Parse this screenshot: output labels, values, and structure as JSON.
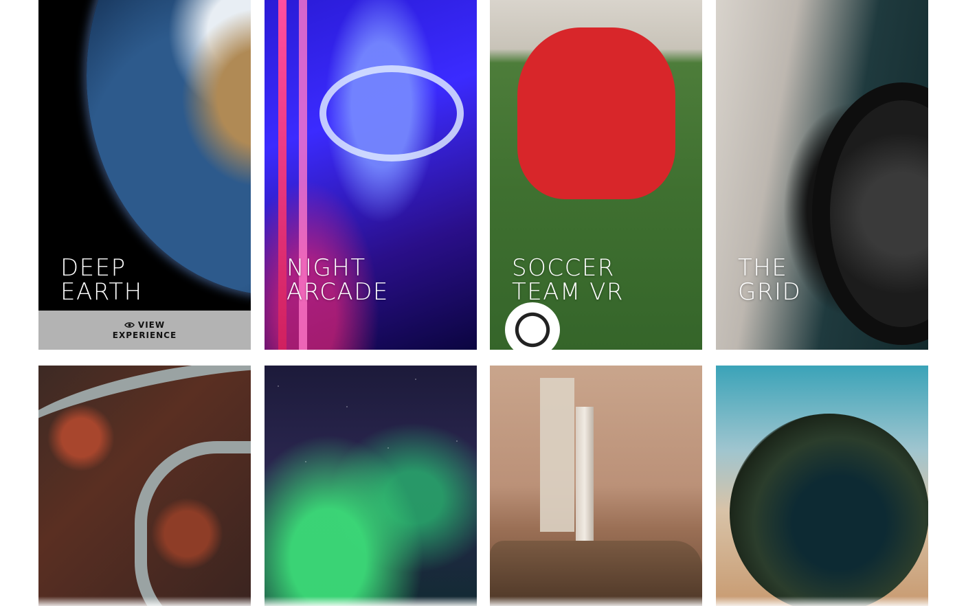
{
  "cards": [
    {
      "title": "DEEP\nEARTH",
      "cta_line1": "VIEW",
      "cta_line2": "EXPERIENCE",
      "cta_icon": "eye-icon"
    },
    {
      "title": "NIGHT\nARCADE"
    },
    {
      "title": "SOCCER\nTEAM VR"
    },
    {
      "title": "THE\nGRID"
    },
    {
      "title": ""
    },
    {
      "title": ""
    },
    {
      "title": ""
    },
    {
      "title": ""
    }
  ],
  "colors": {
    "cta_background": "#b3b3b3",
    "cta_text": "#111111",
    "title_text": "#ffffff",
    "page_background": "#ffffff"
  }
}
